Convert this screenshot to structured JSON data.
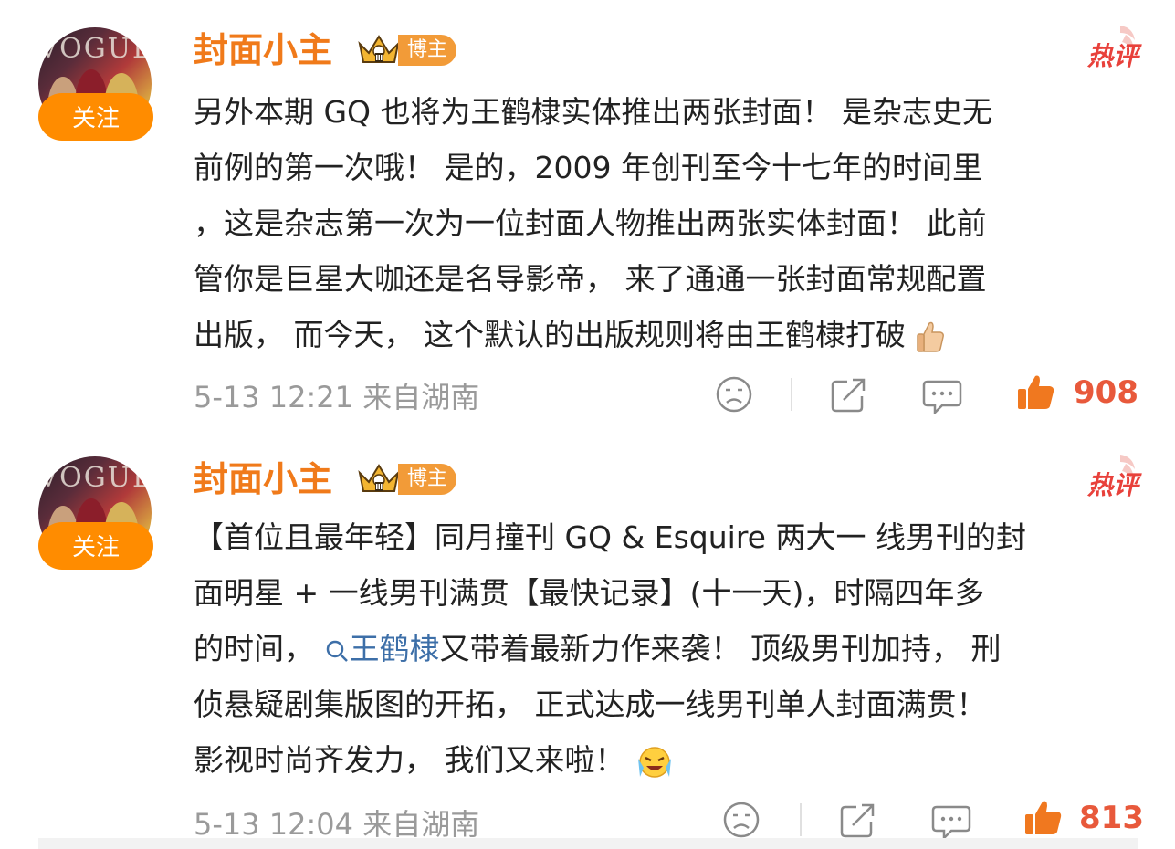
{
  "posts": [
    {
      "username": "封面小主",
      "badge": "博主",
      "hot_label": "热评",
      "follow_label": "关注",
      "avatar_magazine": "VOGUE",
      "content_lines": [
        "另外本期 GQ 也将为王鹤棣实体推出两张封面！ 是杂志史无",
        "前例的第一次哦！ 是的，2009 年创刊至今十七年的时间里",
        "，这是杂志第一次为一位封面人物推出两张实体封面！ 此前",
        "管你是巨星大咖还是名导影帝， 来了通通一张封面常规配置",
        "出版， 而今天， 这个默认的出版规则将由王鹤棣打破"
      ],
      "meta": "5-13 12:21 来自湖南",
      "likes": "908"
    },
    {
      "username": "封面小主",
      "badge": "博主",
      "hot_label": "热评",
      "follow_label": "关注",
      "avatar_magazine": "VOGUE",
      "content_lines": [
        "【首位且最年轻】同月撞刊 GQ & Esquire 两大一 线男刊的封",
        "面明星 + 一线男刊满贯【最快记录】(十一天)，时隔四年多",
        "的时间，",
        "又带着最新力作来袭！ 顶级男刊加持， 刑",
        "侦悬疑剧集版图的开拓， 正式达成一线男刊单人封面满贯！",
        "影视时尚齐发力， 我们又来啦！"
      ],
      "topic": "王鹤棣",
      "meta": "5-13 12:04 来自湖南",
      "likes": "813"
    }
  ],
  "colors": {
    "accent": "#f07a1a",
    "follow_bg": "#ff8c00",
    "badge_bg": "#f29b38",
    "hot": "#e8413b",
    "like": "#e8593b",
    "link": "#3d6fa8",
    "meta": "#9a9a9a"
  },
  "icons": [
    "crown-icon",
    "hot-icon",
    "sad-face-icon",
    "share-icon",
    "comment-icon",
    "thumbs-up-icon",
    "search-icon",
    "thumbs-up-emoji",
    "crying-laugh-emoji"
  ]
}
